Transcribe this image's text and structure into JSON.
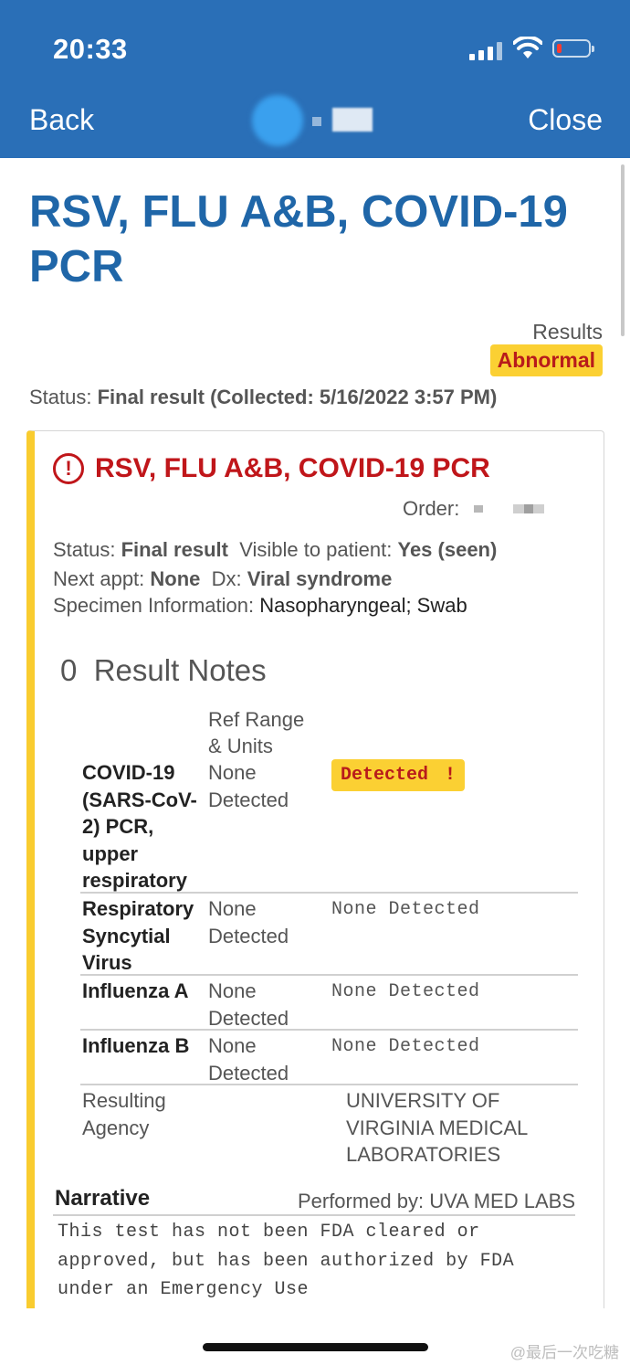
{
  "status_bar": {
    "time": "20:33"
  },
  "nav": {
    "back_label": "Back",
    "close_label": "Close"
  },
  "page": {
    "title": "RSV, FLU A&B, COVID-19 PCR",
    "results_label": "Results",
    "results_badge": "Abnormal",
    "status_prefix": "Status:",
    "status_value": "Final result",
    "collected": "(Collected: 5/16/2022  3:57 PM)"
  },
  "card": {
    "alert_icon": "!",
    "title": "RSV, FLU A&B, COVID-19 PCR",
    "order_label": "Order:",
    "status_label": "Status:",
    "status_value": "Final result",
    "visible_label": "Visible to patient:",
    "visible_value": "Yes (seen)",
    "appt_label": "Next appt:",
    "appt_value": "None",
    "dx_label": "Dx:",
    "dx_value": "Viral syndrome",
    "specimen_label": "Specimen Information:",
    "specimen_value": "Nasopharyngeal; Swab",
    "result_notes_count": "0",
    "result_notes_label": "Result Notes",
    "ref_header": "Ref Range & Units",
    "rows": [
      {
        "name": "COVID-19 (SARS-CoV-2) PCR, upper respiratory",
        "ref": "None Detected",
        "value": "Detected",
        "flag": "!"
      },
      {
        "name": "Respiratory Syncytial Virus",
        "ref": "None Detected",
        "value": "None Detected"
      },
      {
        "name": "Influenza A",
        "ref": "None Detected",
        "value": "None Detected"
      },
      {
        "name": "Influenza B",
        "ref": "None Detected",
        "value": "None Detected"
      }
    ],
    "agency_label": "Resulting Agency",
    "agency_value": "UNIVERSITY OF VIRGINIA MEDICAL LABORATORIES",
    "narrative_label": "Narrative",
    "performed_by": "Performed by: UVA MED LABS",
    "narrative_text": "This test has not been FDA cleared or approved, but has been authorized by FDA under an Emergency Use"
  },
  "watermark": "@最后一次吃糖",
  "colors": {
    "header_bg": "#2a6fb7",
    "title_blue": "#1f66a8",
    "alert_red": "#c0161a",
    "badge_yellow": "#fbd033",
    "card_accent": "#f9cc2f"
  }
}
